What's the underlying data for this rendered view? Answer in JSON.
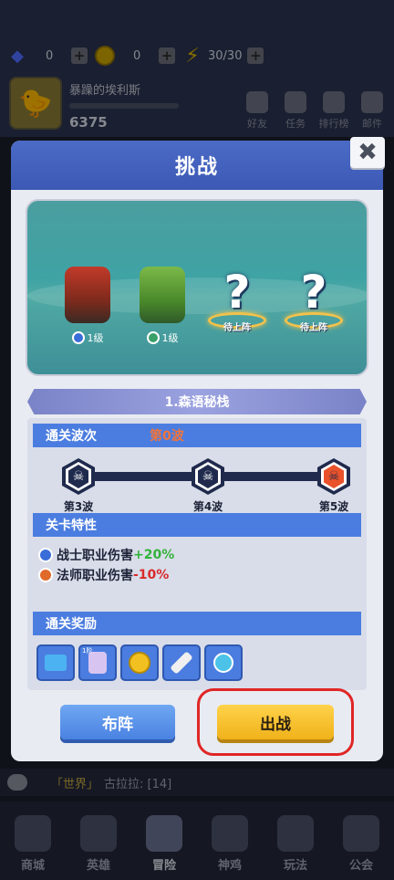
{
  "resources": {
    "gems": "0",
    "coins": "0",
    "energy": "30/30"
  },
  "player": {
    "name": "暴躁的埃利斯",
    "power": "6375"
  },
  "top_menu": [
    "好友",
    "任务",
    "排行榜",
    "邮件"
  ],
  "modal": {
    "title": "挑战",
    "close_label": "✖"
  },
  "scene": {
    "heroes": [
      {
        "level": "1级"
      },
      {
        "level": "1级"
      }
    ],
    "empty_slots": [
      {
        "label": "待上阵"
      },
      {
        "label": "待上阵"
      }
    ]
  },
  "stage": {
    "name": "1.森语秘栈"
  },
  "waves": {
    "header": "通关波次",
    "current": "第0波",
    "nodes": [
      "第3波",
      "第4波",
      "第5波"
    ]
  },
  "features": {
    "header": "关卡特性",
    "items": [
      {
        "text": "战士职业伤害",
        "value": "+20%"
      },
      {
        "text": "法师职业伤害",
        "value": "-10%"
      }
    ]
  },
  "rewards": {
    "header": "通关奖励",
    "items": [
      "ticket",
      "mystery-box",
      "coin",
      "scroll",
      "potion"
    ],
    "mystery_tag": "1阶"
  },
  "buttons": {
    "formation": "布阵",
    "fight": "出战"
  },
  "chat": {
    "channel": "「世界」",
    "text": "古拉拉: [14]"
  },
  "bottom_nav": [
    "商城",
    "英雄",
    "冒险",
    "神鸡",
    "玩法",
    "公会"
  ]
}
